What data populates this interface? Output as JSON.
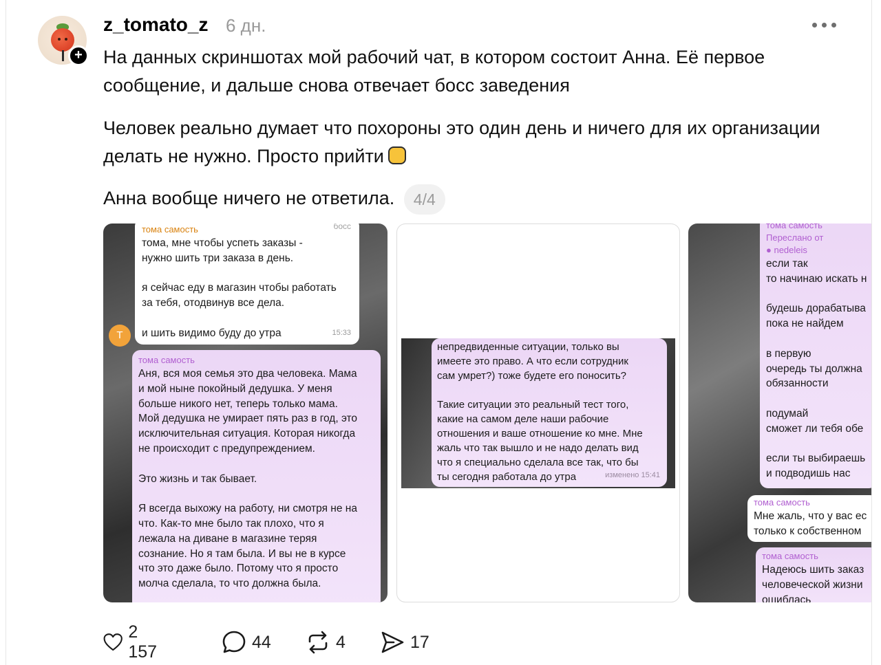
{
  "post": {
    "username": "z_tomato_z",
    "time": "6 дн.",
    "paragraphs": [
      "На данных скриншотах мой рабочий чат, в котором состоит Анна. Её первое сообщение, и дальше снова отвечает босс заведения",
      "Человек реально думает что похороны это один день и ничего для их организации делать не нужно. Просто прийти",
      "Анна вообще ничего не ответила."
    ],
    "emoji": "fist-emoji",
    "image_counter": "4/4"
  },
  "screenshot1": {
    "top_sender": "тома самость",
    "top_tag": "босс",
    "top_lines": [
      "тома, мне чтобы успеть заказы -",
      "нужно шить три заказа в день.",
      "",
      "я сейчас еду в магазин чтобы работать",
      "за тебя, отодвинув все дела.",
      "",
      "и шить видимо буду до утра"
    ],
    "top_time": "15:33",
    "avatar_letter": "Т",
    "main_sender": "тома самость",
    "main_lines": [
      "Аня, вся моя семья это два человека. Мама",
      "и мой ныне покойный дедушка. У меня",
      "больше никого нет, теперь только мама.",
      "Мой дедушка не умирает пять раз в год, это",
      "исключительная ситуация. Которая никогда",
      "не происходит с предупреждением.",
      "",
      "Это жизнь и так бывает.",
      "",
      "Я всегда выхожу на работу, ни смотря не на",
      "что. Как-то мне было так плохо, что я",
      "лежала на диване в магазине теряя",
      "сознание. Но я там была. И вы не в курсе",
      "что это даже было. Потому что я просто",
      "молча сделала, то что должна была."
    ]
  },
  "screenshot2": {
    "lines": [
      "непредвиденные ситуации, только вы",
      "имеете это право. А что если сотрудник",
      "сам умрет?) тоже будете его поносить?",
      "",
      "Такие ситуации это реальный тест того,",
      "какие на самом деле наши рабочие",
      "отношения и ваше отношение ко мне. Мне",
      "жаль что так вышло и не надо делать вид",
      "что я специально сделала все так, что бы",
      "ты сегодня работала до утра"
    ],
    "edited": "изменено 15:41"
  },
  "screenshot3": {
    "sender": "тома самость",
    "forwarded_label": "Переслано от",
    "forwarded_from": "nedeleis",
    "lines": [
      "если так",
      "то начинаю искать н",
      "",
      "будешь дорабатыва",
      "пока не найдем",
      "",
      "в первую",
      "очередь ты должна",
      "обязанности",
      "",
      "подумай",
      "сможет ли тебя обе",
      "",
      "если ты выбираешь",
      "и подводишь нас"
    ],
    "b2_sender": "тома самость",
    "b2_lines": [
      "Мне жаль, что у вас ес",
      "только к собственном"
    ],
    "b3_sender": "тома самость",
    "b3_lines": [
      "Надеюсь шить заказ",
      "человеческой жизни",
      "ошиблась"
    ]
  },
  "actions": {
    "likes": "2 157",
    "comments": "44",
    "reposts": "4",
    "shares": "17"
  }
}
